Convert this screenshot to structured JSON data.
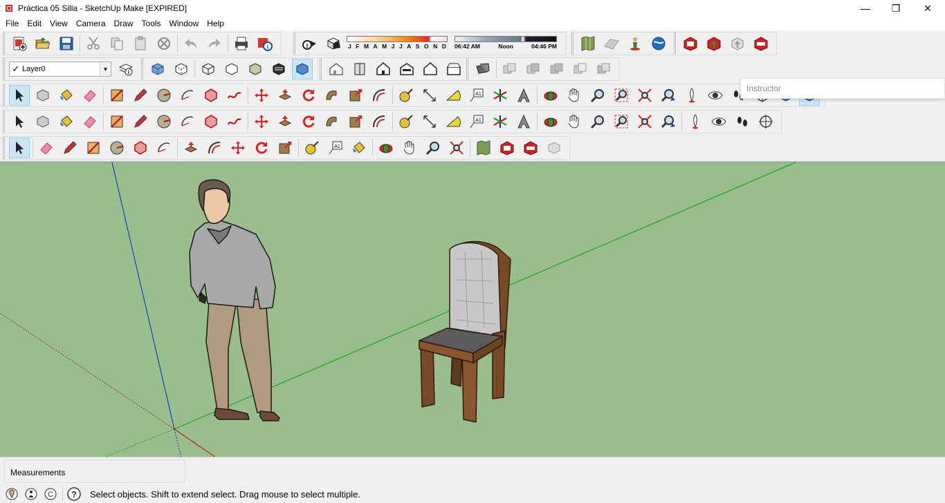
{
  "window": {
    "title": "Práctica 05 Silla - SketchUp Make [EXPIRED]",
    "minimize_glyph": "—",
    "maximize_glyph": "❐",
    "close_glyph": "✕"
  },
  "menu": [
    "File",
    "Edit",
    "View",
    "Camera",
    "Draw",
    "Tools",
    "Window",
    "Help"
  ],
  "layer": {
    "current": "Layer0",
    "check_glyph": "✓",
    "drop_glyph": "▼"
  },
  "shadow_settings": {
    "months": [
      "J",
      "F",
      "M",
      "A",
      "M",
      "J",
      "J",
      "A",
      "S",
      "O",
      "N",
      "D"
    ],
    "time_start": "06:42 AM",
    "time_mid": "Noon",
    "time_end": "04:46 PM"
  },
  "instructor": {
    "label": "Instructor"
  },
  "measurements": {
    "label": "Measurements",
    "value": ""
  },
  "status": {
    "message": "Select objects. Shift to extend select. Drag mouse to select multiple."
  },
  "colors": {
    "viewport_ground": "#99bd8c",
    "axis_red": "#c00000",
    "axis_green": "#00a000",
    "axis_blue": "#1020c0",
    "select_highlight": "#cce4f7"
  }
}
